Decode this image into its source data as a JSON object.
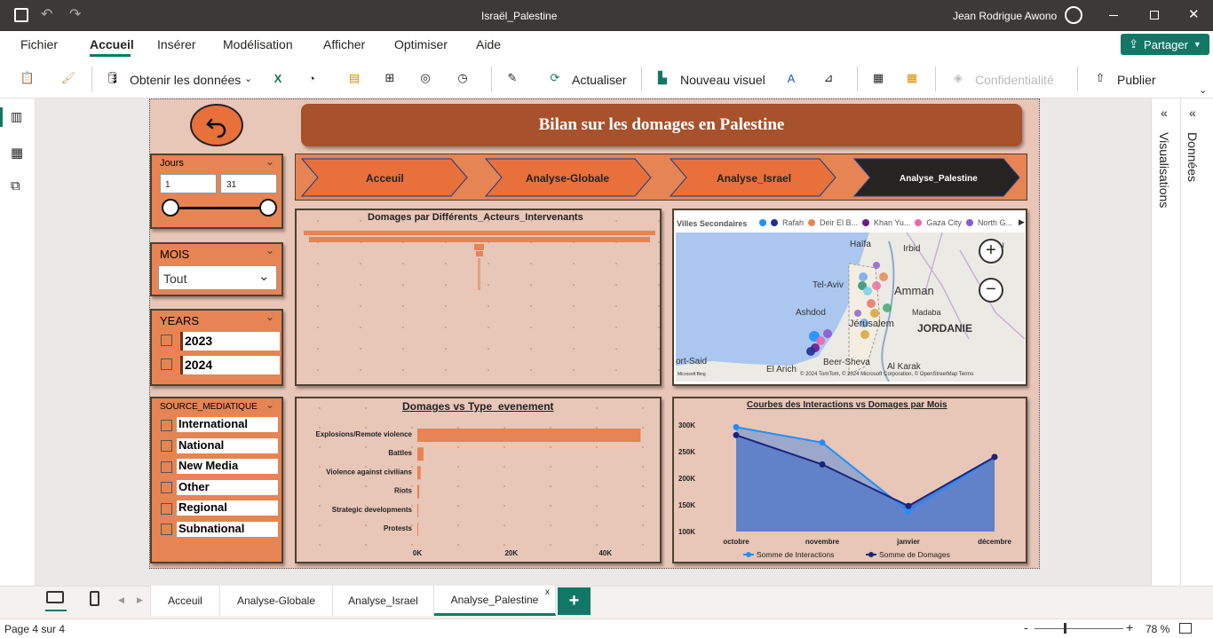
{
  "titlebar": {
    "title": "Israël_Palestine",
    "user": "Jean Rodrigue Awono"
  },
  "menu": {
    "items": [
      "Fichier",
      "Accueil",
      "Insérer",
      "Modélisation",
      "Afficher",
      "Optimiser",
      "Aide"
    ],
    "active": "Accueil",
    "share": "Partager"
  },
  "ribbon": {
    "get_data": "Obtenir les données",
    "refresh": "Actualiser",
    "new_visual": "Nouveau visuel",
    "confidential": "Confidentialité",
    "publish": "Publier"
  },
  "rightpane": {
    "visualisations": "Visualisations",
    "data": "Données"
  },
  "report": {
    "title": "Bilan sur les domages en Palestine",
    "nav": [
      "Acceuil",
      "Analyse-Globale",
      "Analyse_Israel",
      "Analyse_Palestine"
    ],
    "slicer_days": {
      "title": "Jours",
      "min": "1",
      "max": "31"
    },
    "slicer_month": {
      "title": "MOIS",
      "value": "Tout"
    },
    "slicer_years": {
      "title": "YEARS",
      "items": [
        "2023",
        "2024"
      ]
    },
    "slicer_source": {
      "title": "SOURCE_MEDIATIQUE",
      "items": [
        "International",
        "National",
        "New Media",
        "Other",
        "Regional",
        "Subnational"
      ]
    },
    "chart_acteurs_title": "Domages par Différents_Acteurs_Intervenants",
    "map": {
      "legend_title": "Villes Secondaires",
      "legend": [
        {
          "name": "Rafah",
          "color": "#1f2f9a"
        },
        {
          "name": "Deir El B...",
          "color": "#e68453"
        },
        {
          "name": "Khan Yu...",
          "color": "#6a1b8a"
        },
        {
          "name": "Gaza City",
          "color": "#e86aa8"
        },
        {
          "name": "North G...",
          "color": "#8a5ad0"
        }
      ],
      "labels": {
        "haifa": "Haïfa",
        "irbid": "Irbid",
        "sou": "Sou",
        "telaviv": "Tel-Aviv",
        "amman": "Amman",
        "ashdod": "Ashdod",
        "jerusalem": "Jérusalem",
        "madaba": "Madaba",
        "jordanie": "JORDANIE",
        "portsaid": "ort-Said",
        "beersheva": "Beer-Sheva",
        "elarich": "El Arich",
        "alkarak": "Al Karak"
      },
      "attribution": "© 2024 TomTom, © 2024 Microsoft Corporation, © OpenStreetMap  Terms",
      "brand": "Microsoft Bing"
    },
    "chart_events_title": "Domages vs Type_evenement",
    "chart_lines_title": "Courbes des Interactions vs Domages par Mois"
  },
  "chart_data": [
    {
      "type": "bar",
      "title": "Domages vs Type_evenement",
      "categories": [
        "Explosions/Remote violence",
        "Battles",
        "Violence against civilians",
        "Riots",
        "Strategic developments",
        "Protests"
      ],
      "values": [
        47500,
        1300,
        700,
        400,
        200,
        50
      ],
      "xticks": [
        "0K",
        "20K",
        "40K"
      ],
      "xlim": [
        0,
        48000
      ],
      "color": "#e68453"
    },
    {
      "type": "line",
      "title": "Courbes des Interactions vs Domages par Mois",
      "categories": [
        "octobre",
        "novembre",
        "janvier",
        "décembre"
      ],
      "yticks": [
        "100K",
        "150K",
        "200K",
        "250K",
        "300K"
      ],
      "ylim": [
        100000,
        300000
      ],
      "series": [
        {
          "name": "Somme de Interactions",
          "values": [
            296000,
            267000,
            138000,
            240000
          ],
          "color": "#1e90ff"
        },
        {
          "name": "Somme de Domages",
          "values": [
            281000,
            226000,
            148000,
            240000
          ],
          "color": "#1a237e"
        }
      ]
    }
  ],
  "tabs": {
    "items": [
      "Acceuil",
      "Analyse-Globale",
      "Analyse_Israel",
      "Analyse_Palestine"
    ],
    "active": "Analyse_Palestine"
  },
  "status": {
    "page": "Page 4 sur 4",
    "zoom": "78 %"
  }
}
